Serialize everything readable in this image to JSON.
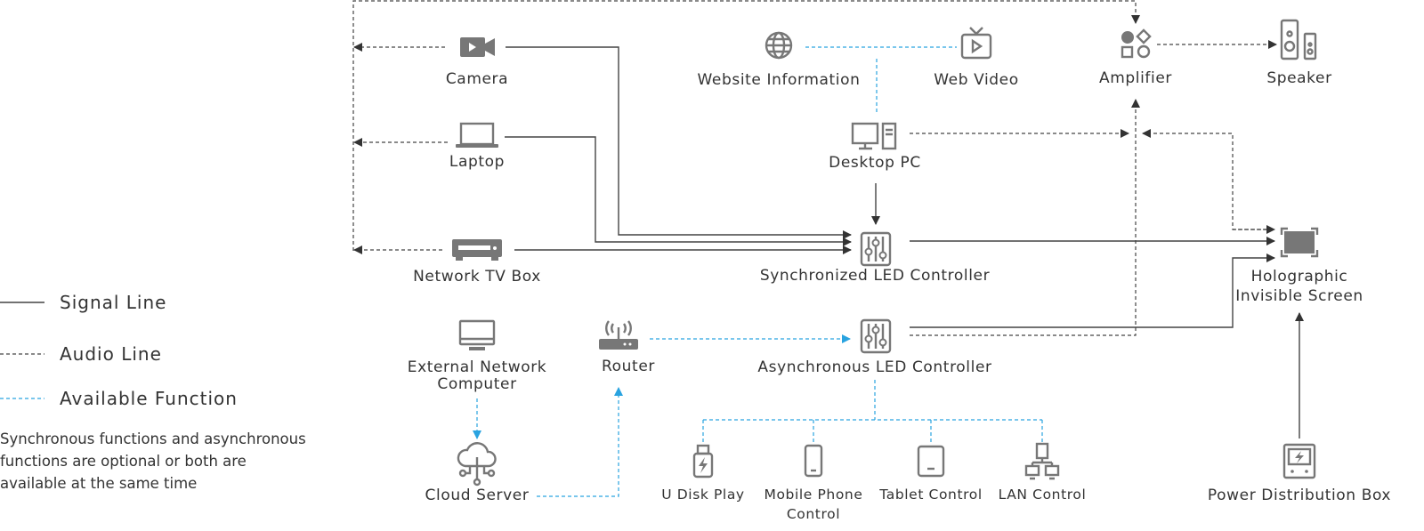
{
  "colors": {
    "signal": "#444444",
    "audio": "#444444",
    "function": "#29a3e0",
    "icon": "#777777",
    "text": "#333333"
  },
  "legend": {
    "signal": "Signal Line",
    "audio": "Audio Line",
    "function": "Available Function",
    "note": [
      "Synchronous functions and asynchronous",
      "functions are optional or both are",
      "available at the same time"
    ]
  },
  "nodes": {
    "camera": {
      "label": "Camera",
      "icon": "video-camera-icon"
    },
    "laptop": {
      "label": "Laptop",
      "icon": "laptop-icon"
    },
    "tvbox": {
      "label": "Network TV Box",
      "icon": "set-top-box-icon"
    },
    "website": {
      "label": "Website Information",
      "icon": "globe-icon"
    },
    "webvideo": {
      "label": "Web Video",
      "icon": "tv-play-icon"
    },
    "desktop": {
      "label": "Desktop PC",
      "icon": "desktop-pc-icon"
    },
    "sync": {
      "label": "Synchronized LED Controller",
      "icon": "sliders-icon"
    },
    "async": {
      "label": "Asynchronous LED Controller",
      "icon": "sliders-icon"
    },
    "amplifier": {
      "label": "Amplifier",
      "icon": "shapes-icon"
    },
    "speaker": {
      "label": "Speaker",
      "icon": "speaker-icon"
    },
    "screen": {
      "label": [
        "Holographic",
        "Invisible Screen"
      ],
      "icon": "screen-icon"
    },
    "power": {
      "label": "Power Distribution Box",
      "icon": "power-box-icon"
    },
    "extpc": {
      "label": [
        "External Network",
        "Computer"
      ],
      "icon": "monitor-icon"
    },
    "router": {
      "label": "Router",
      "icon": "router-icon"
    },
    "cloud": {
      "label": "Cloud Server",
      "icon": "cloud-server-icon"
    },
    "udisk": {
      "label": "U Disk Play",
      "icon": "usb-drive-icon"
    },
    "mobile": {
      "label": [
        "Mobile Phone",
        "Control"
      ],
      "icon": "mobile-phone-icon"
    },
    "tablet": {
      "label": "Tablet Control",
      "icon": "tablet-icon"
    },
    "lan": {
      "label": "LAN Control",
      "icon": "lan-icon"
    }
  }
}
